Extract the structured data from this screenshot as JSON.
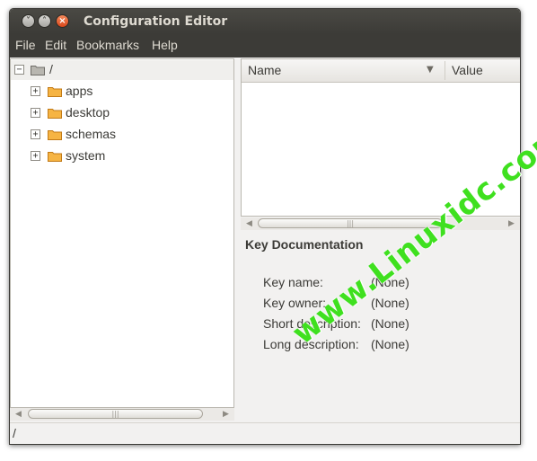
{
  "window": {
    "title": "Configuration Editor",
    "buttons": {
      "minimize": "˅",
      "maximize": "˄",
      "close": "×"
    }
  },
  "menubar": {
    "items": [
      "File",
      "Edit",
      "Bookmarks",
      "Help"
    ]
  },
  "tree": {
    "root": {
      "label": "/",
      "expander": "−"
    },
    "children": [
      {
        "label": "apps",
        "expander": "+"
      },
      {
        "label": "desktop",
        "expander": "+"
      },
      {
        "label": "schemas",
        "expander": "+"
      },
      {
        "label": "system",
        "expander": "+"
      }
    ]
  },
  "list": {
    "columns": {
      "name": "Name",
      "value": "Value"
    },
    "sort_indicator": "▼"
  },
  "key_doc": {
    "title": "Key Documentation",
    "fields": [
      {
        "label": "Key name:",
        "value": "(None)"
      },
      {
        "label": "Key owner:",
        "value": "(None)"
      },
      {
        "label": "Short description:",
        "value": "(None)"
      },
      {
        "label": "Long description:",
        "value": "(None)"
      }
    ]
  },
  "statusbar": {
    "path": "/"
  },
  "watermark": {
    "text": "www.Linuxidc.com"
  },
  "colors": {
    "titlebar": "#3c3b37",
    "close_button": "#e9541f",
    "watermark": "#3fe01f"
  }
}
